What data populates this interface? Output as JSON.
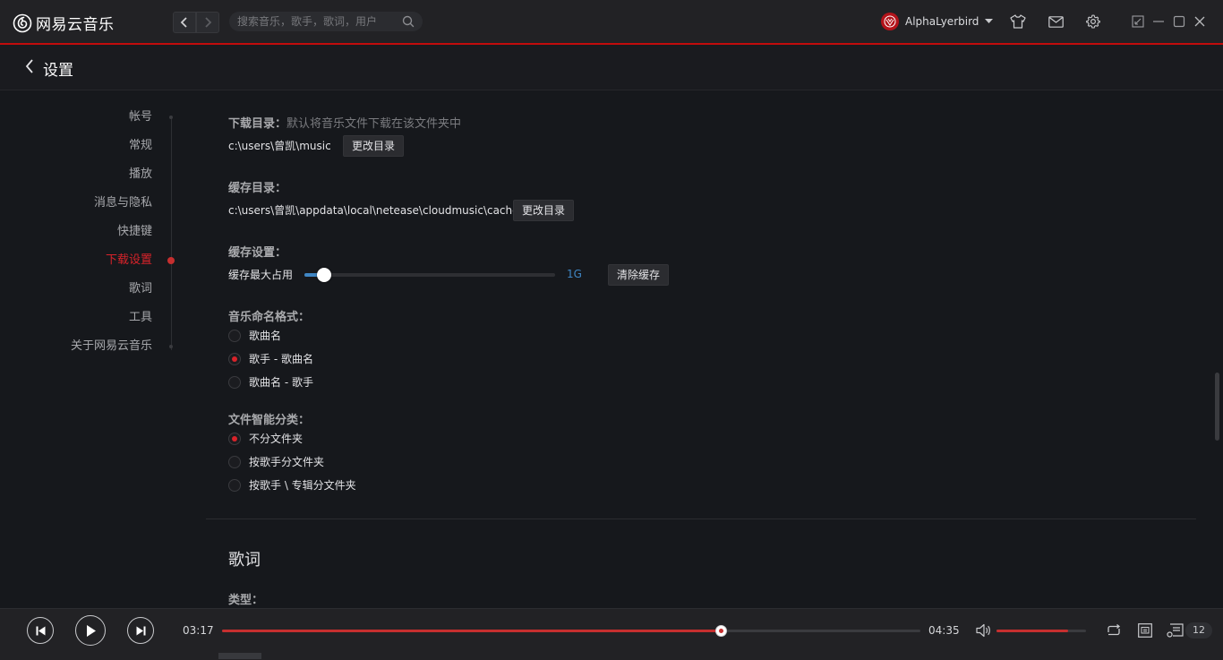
{
  "app": {
    "name": "网易云音乐"
  },
  "search": {
    "placeholder": "搜索音乐，歌手，歌词，用户"
  },
  "user": {
    "name": "AlphaLyerbird"
  },
  "header": {
    "title": "设置"
  },
  "sidebar": {
    "items": [
      {
        "label": "帐号",
        "active": false
      },
      {
        "label": "常规",
        "active": false
      },
      {
        "label": "播放",
        "active": false
      },
      {
        "label": "消息与隐私",
        "active": false
      },
      {
        "label": "快捷键",
        "active": false
      },
      {
        "label": "下载设置",
        "active": true
      },
      {
        "label": "歌词",
        "active": false
      },
      {
        "label": "工具",
        "active": false
      },
      {
        "label": "关于网易云音乐",
        "active": false
      }
    ]
  },
  "download": {
    "dir_label": "下载目录：",
    "dir_hint": "默认将音乐文件下载在该文件夹中",
    "dir_path": "c:\\users\\曾凯\\music",
    "dir_button": "更改目录",
    "cache_dir_label": "缓存目录：",
    "cache_dir_path": "c:\\users\\曾凯\\appdata\\local\\netease\\cloudmusic\\cache",
    "cache_dir_button": "更改目录",
    "cache_settings_label": "缓存设置：",
    "cache_max_label": "缓存最大占用",
    "cache_max_value": "1G",
    "cache_max_fraction": 0.08,
    "clear_cache_button": "清除缓存",
    "naming_label": "音乐命名格式：",
    "naming_options": [
      {
        "label": "歌曲名",
        "checked": false
      },
      {
        "label": "歌手 - 歌曲名",
        "checked": true
      },
      {
        "label": "歌曲名 - 歌手",
        "checked": false
      }
    ],
    "sort_label": "文件智能分类：",
    "sort_options": [
      {
        "label": "不分文件夹",
        "checked": true
      },
      {
        "label": "按歌手分文件夹",
        "checked": false
      },
      {
        "label": "按歌手 \\ 专辑分文件夹",
        "checked": false
      }
    ]
  },
  "lyrics_section": {
    "title": "歌词",
    "type_label": "类型："
  },
  "player": {
    "current_time": "03:17",
    "total_time": "04:35",
    "progress": 0.716,
    "volume": 0.8,
    "playlist_count": "12"
  },
  "colors": {
    "accent": "#c62f2f",
    "active_text": "#d8232a",
    "slider": "#3f86c4"
  }
}
